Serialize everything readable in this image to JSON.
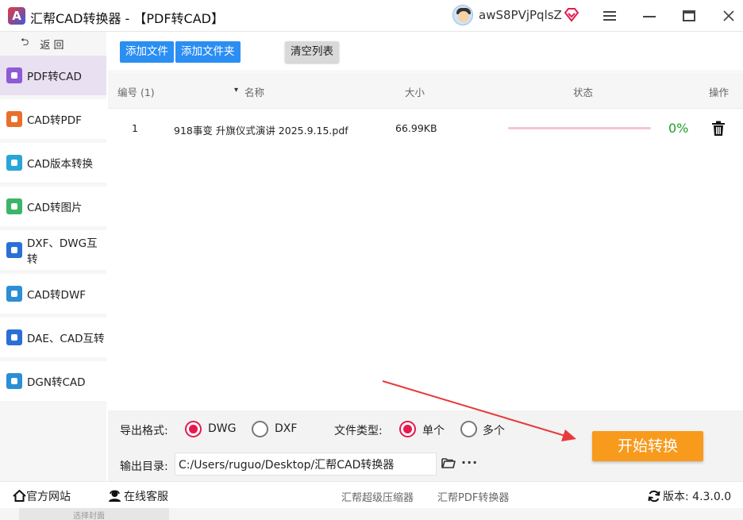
{
  "app": {
    "title": "汇帮CAD转换器 - 【PDF转CAD】",
    "user_name": "awS8PVjPqlsZ"
  },
  "window_controls": {
    "menu": "≡",
    "minimize": "—",
    "maximize": "▭",
    "close": "✕"
  },
  "sidebar": {
    "back_label": "返 回",
    "items": [
      {
        "label": "PDF转CAD",
        "color": "#8e5bd6"
      },
      {
        "label": "CAD转PDF",
        "color": "#e8702a"
      },
      {
        "label": "CAD版本转换",
        "color": "#2aa6d6"
      },
      {
        "label": "CAD转图片",
        "color": "#3bb56a"
      },
      {
        "label": "DXF、DWG互转",
        "color": "#2b6fd6"
      },
      {
        "label": "CAD转DWF",
        "color": "#2b8ed6"
      },
      {
        "label": "DAE、CAD互转",
        "color": "#2b6fd6"
      },
      {
        "label": "DGN转CAD",
        "color": "#2b8ed6"
      }
    ]
  },
  "toolbar": {
    "add_file": "添加文件",
    "add_folder": "添加文件夹",
    "clear_list": "清空列表"
  },
  "table": {
    "headers": {
      "index": "编号 (1)",
      "sort_arrow": "▾",
      "name": "名称",
      "size": "大小",
      "status": "状态",
      "action": "操作"
    },
    "rows": [
      {
        "index": "1",
        "name": "918事变 升旗仪式演讲 2025.9.15.pdf",
        "size": "66.99KB",
        "progress_text": "0%",
        "progress": 0
      }
    ]
  },
  "options": {
    "format_label": "导出格式:",
    "format_dwg": "DWG",
    "format_dxf": "DXF",
    "type_label": "文件类型:",
    "type_single": "单个",
    "type_multi": "多个",
    "output_label": "输出目录:",
    "output_path": "C:/Users/ruguo/Desktop/汇帮CAD转换器",
    "more": "···",
    "start_button": "开始转换"
  },
  "statusbar": {
    "website": "官方网站",
    "support": "在线客服",
    "link_compressor": "汇帮超级压缩器",
    "link_pdf": "汇帮PDF转换器",
    "version": "版本: 4.3.0.0"
  },
  "colors": {
    "accent_blue": "#2b8ef3",
    "accent_orange": "#f89a1c",
    "radio_selected": "#e5194e",
    "progress_green": "#1f9d2f",
    "annotation_red": "#e83a3a"
  },
  "below_window": {
    "card_text": "选择封面"
  }
}
